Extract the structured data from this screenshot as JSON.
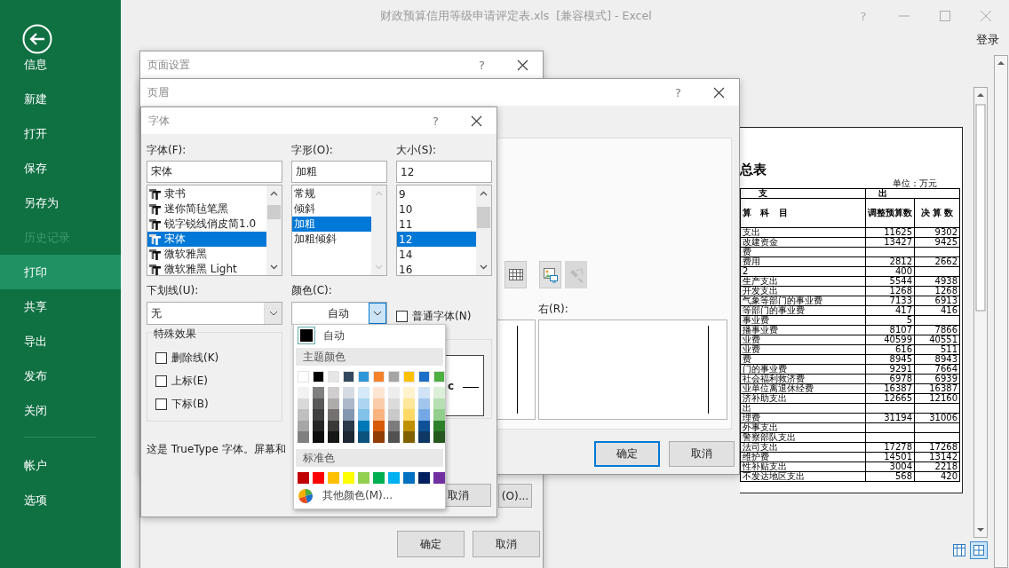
{
  "window": {
    "title": "财政预算信用等级申请评定表.xls  [兼容模式] - Excel",
    "help": "?",
    "sign_in": "登录"
  },
  "sidebar": {
    "items": [
      {
        "label": "信息",
        "selected": false,
        "disabled": false
      },
      {
        "label": "新建",
        "selected": false,
        "disabled": false
      },
      {
        "label": "打开",
        "selected": false,
        "disabled": false
      },
      {
        "label": "保存",
        "selected": false,
        "disabled": false
      },
      {
        "label": "另存为",
        "selected": false,
        "disabled": false
      },
      {
        "label": "历史记录",
        "selected": false,
        "disabled": true
      },
      {
        "label": "打印",
        "selected": true,
        "disabled": false
      },
      {
        "label": "共享",
        "selected": false,
        "disabled": false
      },
      {
        "label": "导出",
        "selected": false,
        "disabled": false
      },
      {
        "label": "发布",
        "selected": false,
        "disabled": false
      },
      {
        "label": "关闭",
        "selected": false,
        "disabled": false
      }
    ],
    "bottom_items": [
      {
        "label": "帐户",
        "selected": false,
        "disabled": false
      },
      {
        "label": "选项",
        "selected": false,
        "disabled": false
      }
    ]
  },
  "preview": {
    "title": "总表",
    "unit": "单位：万元",
    "group_headers": [
      "支",
      "出"
    ],
    "columns": [
      "算   科   目",
      "调整预算数",
      "决 算 数"
    ],
    "rows": [
      {
        "item": "支出",
        "budget": "11625",
        "final": "9302"
      },
      {
        "item": "改建资金",
        "budget": "13427",
        "final": "9425"
      },
      {
        "item": "费"
      },
      {
        "item": "费用",
        "budget": "2812",
        "final": "2662"
      },
      {
        "item": "2",
        "budget": "400"
      },
      {
        "item": "生产支出",
        "budget": "5544",
        "final": "4938"
      },
      {
        "item": "开发支出",
        "budget": "1268",
        "final": "1268"
      },
      {
        "item": "气象等部门的事业费",
        "budget": "7133",
        "final": "6913"
      },
      {
        "item": "等部门的事业费",
        "budget": "417",
        "final": "416"
      },
      {
        "item": "事业费",
        "budget": "5"
      },
      {
        "item": "播事业费",
        "budget": "8107",
        "final": "7866"
      },
      {
        "item": "业费",
        "budget": "40599",
        "final": "40551"
      },
      {
        "item": "业费",
        "budget": "616",
        "final": "511"
      },
      {
        "item": "费",
        "budget": "8945",
        "final": "8943"
      },
      {
        "item": "门的事业费",
        "budget": "9291",
        "final": "7664"
      },
      {
        "item": "社会福利救济费",
        "budget": "6978",
        "final": "6939"
      },
      {
        "item": "业单位离退休经费",
        "budget": "16387",
        "final": "16387"
      },
      {
        "item": "济补助支出",
        "budget": "12665",
        "final": "12160"
      },
      {
        "item": "出"
      },
      {
        "item": "理费",
        "budget": "31194",
        "final": "31006"
      },
      {
        "item": "外事支出"
      },
      {
        "item": "警察部队支出"
      },
      {
        "item": "法司支出",
        "budget": "17278",
        "final": "17268"
      },
      {
        "item": "维护费",
        "budget": "14501",
        "final": "13142"
      },
      {
        "item": "性补贴支出",
        "budget": "3004",
        "final": "2218"
      },
      {
        "item": "不发达地区支出",
        "budget": "568",
        "final": "420"
      }
    ]
  },
  "page_setup_dialog": {
    "title": "页面设置",
    "help": "?",
    "options_button": "(O)...",
    "buttons": [
      "确定",
      "取消"
    ]
  },
  "header_dialog": {
    "title": "页眉",
    "help": "?",
    "right_label": "右(R):",
    "tools": [
      {
        "kind": "table",
        "disabled": false
      },
      {
        "kind": "picture",
        "disabled": false
      },
      {
        "kind": "format",
        "disabled": true
      }
    ],
    "buttons": [
      {
        "label": "确定",
        "default": true
      },
      {
        "label": "取消",
        "default": false
      }
    ]
  },
  "font_dialog": {
    "title": "字体",
    "help": "?",
    "lists": [
      {
        "label": "字体(F):",
        "value": "宋体",
        "scrollbar_disabled": false,
        "items": [
          {
            "label": "隶书",
            "kind": "truetype",
            "selected": false
          },
          {
            "label": "迷你简毡笔黑",
            "kind": "truetype",
            "selected": false
          },
          {
            "label": "锐字锐线俏皮简1.0",
            "kind": "truetype",
            "selected": false
          },
          {
            "label": "宋体",
            "kind": "truetype",
            "selected": true
          },
          {
            "label": "微软雅黑",
            "kind": "truetype",
            "selected": false
          },
          {
            "label": "微软雅黑 Light",
            "kind": "truetype",
            "selected": false
          }
        ]
      },
      {
        "label": "字形(O):",
        "value": "加粗",
        "scrollbar_disabled": true,
        "items": [
          {
            "label": "常规",
            "kind": "plain",
            "selected": false
          },
          {
            "label": "倾斜",
            "kind": "plain",
            "selected": false
          },
          {
            "label": "加粗",
            "kind": "plain",
            "selected": true
          },
          {
            "label": "加粗倾斜",
            "kind": "plain",
            "selected": false
          }
        ]
      },
      {
        "label": "大小(S):",
        "value": "12",
        "scrollbar_disabled": false,
        "items": [
          {
            "label": "9",
            "kind": "plain",
            "selected": false
          },
          {
            "label": "10",
            "kind": "plain",
            "selected": false
          },
          {
            "label": "11",
            "kind": "plain",
            "selected": false
          },
          {
            "label": "12",
            "kind": "plain",
            "selected": true
          },
          {
            "label": "14",
            "kind": "plain",
            "selected": false
          },
          {
            "label": "16",
            "kind": "plain",
            "selected": false
          }
        ]
      }
    ],
    "underline": {
      "label": "下划线(U):",
      "value": "无"
    },
    "color": {
      "label": "颜色(C):",
      "value": "自动",
      "expanded": true
    },
    "normal_font": {
      "label": "普通字体(N)",
      "checked": false
    },
    "effects": {
      "title": "特殊效果",
      "items": [
        {
          "label": "删除线(K)",
          "checked": false
        },
        {
          "label": "上标(E)",
          "checked": false
        },
        {
          "label": "下标(B)",
          "checked": false
        }
      ]
    },
    "preview_text": "c",
    "description": "这是 TrueType 字体。屏幕和",
    "cancel": "取消"
  },
  "color_menu": {
    "automatic": {
      "label": "自动",
      "color": "#000000"
    },
    "theme_title": "主题颜色",
    "theme_colors": [
      {
        "color": "#ffffff",
        "shades": [
          {
            "color": "#f2f2f2"
          },
          {
            "color": "#d9d9d9"
          },
          {
            "color": "#bfbfbf"
          },
          {
            "color": "#a6a6a6"
          },
          {
            "color": "#808080"
          }
        ]
      },
      {
        "color": "#000000",
        "shades": [
          {
            "color": "#7f7f7f"
          },
          {
            "color": "#595959"
          },
          {
            "color": "#404040"
          },
          {
            "color": "#262626"
          },
          {
            "color": "#0d0d0d"
          }
        ]
      },
      {
        "color": "#e7e6e6",
        "shades": [
          {
            "color": "#d0cece"
          },
          {
            "color": "#aeabab"
          },
          {
            "color": "#757171"
          },
          {
            "color": "#3b3838"
          },
          {
            "color": "#181717"
          }
        ]
      },
      {
        "color": "#34495e",
        "shades": [
          {
            "color": "#d6dce4"
          },
          {
            "color": "#adb9ca"
          },
          {
            "color": "#8497b0"
          },
          {
            "color": "#2a3a4b"
          },
          {
            "color": "#1d2834"
          }
        ]
      },
      {
        "color": "#2e97d8",
        "shades": [
          {
            "color": "#d5eaf7"
          },
          {
            "color": "#abd5f0"
          },
          {
            "color": "#82c1e8"
          },
          {
            "color": "#0077b6"
          },
          {
            "color": "#0b527c"
          }
        ]
      },
      {
        "color": "#f5812b",
        "shades": [
          {
            "color": "#fde5d4"
          },
          {
            "color": "#fbccaa"
          },
          {
            "color": "#f9b37f"
          },
          {
            "color": "#d85b0a"
          },
          {
            "color": "#903d06"
          }
        ]
      },
      {
        "color": "#a5a5a5",
        "shades": [
          {
            "color": "#ededed"
          },
          {
            "color": "#dbdbdb"
          },
          {
            "color": "#c9c9c9"
          },
          {
            "color": "#7c7c7c"
          },
          {
            "color": "#525252"
          }
        ]
      },
      {
        "color": "#ffc000",
        "shades": [
          {
            "color": "#fff2cc"
          },
          {
            "color": "#ffe699"
          },
          {
            "color": "#ffd966"
          },
          {
            "color": "#bf9000"
          },
          {
            "color": "#806000"
          }
        ]
      },
      {
        "color": "#1b6fc8",
        "shades": [
          {
            "color": "#d0e2f6"
          },
          {
            "color": "#a2c5ed"
          },
          {
            "color": "#74a8e4"
          },
          {
            "color": "#0f5196"
          },
          {
            "color": "#0e3764"
          }
        ]
      },
      {
        "color": "#4caf40",
        "shades": [
          {
            "color": "#dbefd9"
          },
          {
            "color": "#b7dfb3"
          },
          {
            "color": "#93cf8c"
          },
          {
            "color": "#2e7f2a"
          },
          {
            "color": "#26571f"
          }
        ]
      }
    ],
    "standard_title": "标准色",
    "standard_colors": [
      {
        "color": "#c00000"
      },
      {
        "color": "#ff0000"
      },
      {
        "color": "#ffc000"
      },
      {
        "color": "#ffff00"
      },
      {
        "color": "#92d050"
      },
      {
        "color": "#00b050"
      },
      {
        "color": "#00b0f0"
      },
      {
        "color": "#0070c0"
      },
      {
        "color": "#002060"
      },
      {
        "color": "#7030a0"
      }
    ],
    "more": "其他颜色(M)..."
  }
}
